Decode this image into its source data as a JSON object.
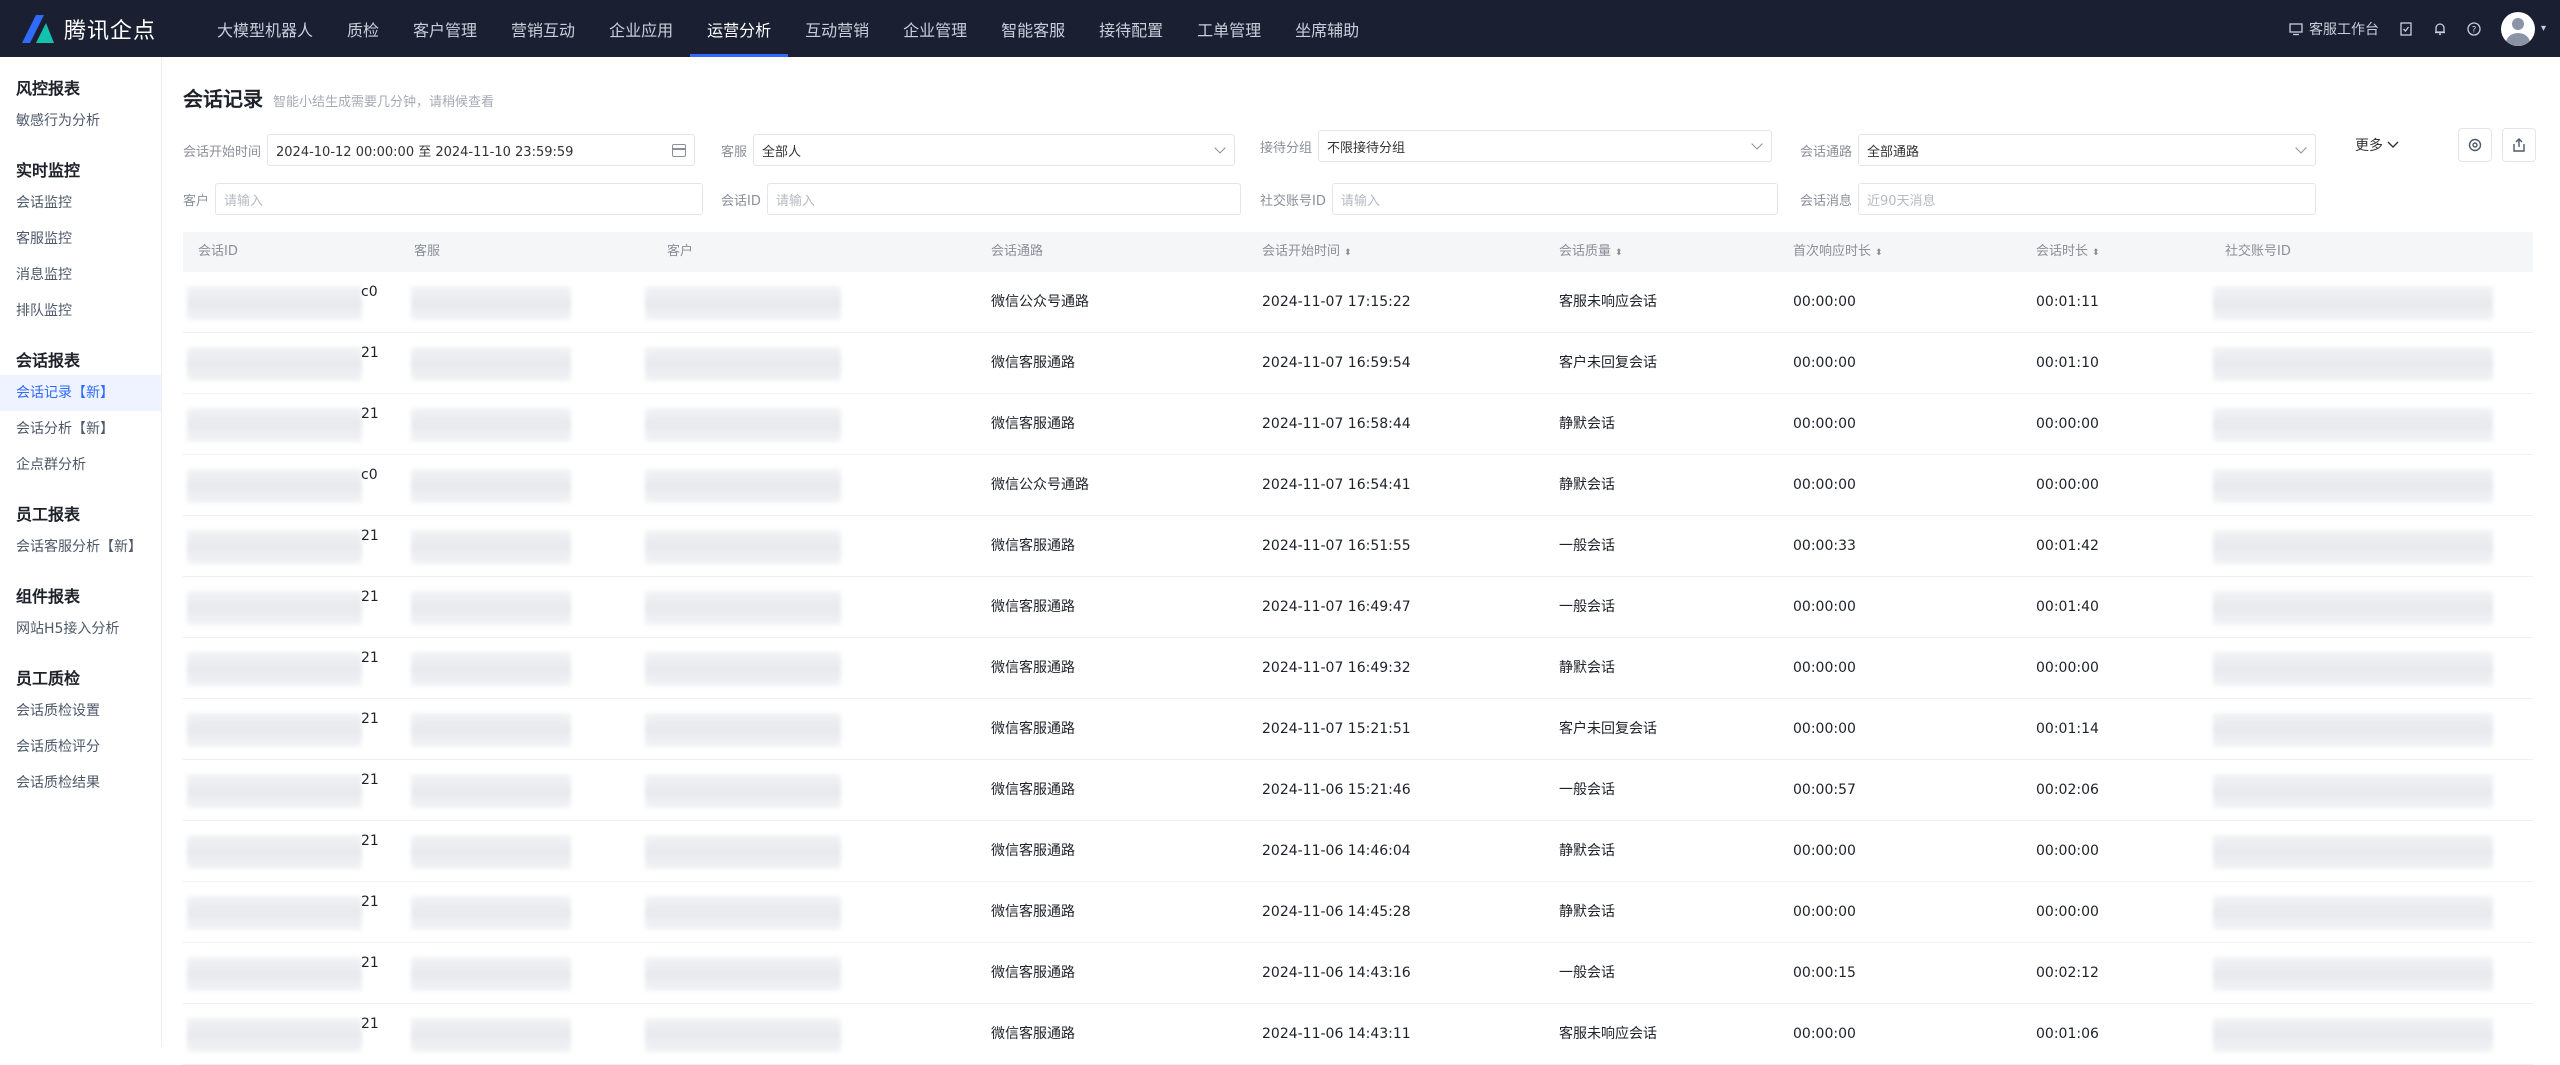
{
  "brand": {
    "name": "腾讯企点"
  },
  "nav": [
    {
      "label": "大模型机器人"
    },
    {
      "label": "质检"
    },
    {
      "label": "客户管理"
    },
    {
      "label": "营销互动"
    },
    {
      "label": "企业应用"
    },
    {
      "label": "运营分析",
      "active": true
    },
    {
      "label": "互动营销"
    },
    {
      "label": "企业管理"
    },
    {
      "label": "智能客服"
    },
    {
      "label": "接待配置"
    },
    {
      "label": "工单管理"
    },
    {
      "label": "坐席辅助"
    }
  ],
  "topright": {
    "workbench": "客服工作台"
  },
  "sidebar": [
    {
      "title": "风控报表",
      "items": [
        {
          "label": "敏感行为分析"
        }
      ]
    },
    {
      "title": "实时监控",
      "items": [
        {
          "label": "会话监控"
        },
        {
          "label": "客服监控"
        },
        {
          "label": "消息监控"
        },
        {
          "label": "排队监控"
        }
      ]
    },
    {
      "title": "会话报表",
      "items": [
        {
          "label": "会话记录【新】",
          "active": true
        },
        {
          "label": "会话分析【新】"
        },
        {
          "label": "企点群分析"
        }
      ]
    },
    {
      "title": "员工报表",
      "items": [
        {
          "label": "会话客服分析【新】"
        }
      ]
    },
    {
      "title": "组件报表",
      "items": [
        {
          "label": "网站H5接入分析"
        }
      ]
    },
    {
      "title": "员工质检",
      "items": [
        {
          "label": "会话质检设置"
        },
        {
          "label": "会话质检评分"
        },
        {
          "label": "会话质检结果"
        }
      ]
    }
  ],
  "page": {
    "title": "会话记录",
    "subtitle": "智能小结生成需要几分钟，请稍候查看"
  },
  "filters": {
    "start_time_label": "会话开始时间",
    "start_time_value": "2024-10-12 00:00:00 至 2024-11-10 23:59:59",
    "agent_label": "客服",
    "agent_value": "全部人",
    "group_label": "接待分组",
    "group_value": "不限接待分组",
    "channel_label": "会话通路",
    "channel_value": "全部通路",
    "more_label": "更多",
    "customer_label": "客户",
    "customer_placeholder": "请输入",
    "session_id_label": "会话ID",
    "session_id_placeholder": "请输入",
    "social_label": "社交账号ID",
    "social_placeholder": "请输入",
    "message_label": "会话消息",
    "message_placeholder": "近90天消息"
  },
  "table": {
    "headers": {
      "session_id": "会话ID",
      "agent": "客服",
      "customer": "客户",
      "channel": "会话通路",
      "start_time": "会话开始时间",
      "quality": "会话质量",
      "first_response": "首次响应时长",
      "duration": "会话时长",
      "social_id": "社交账号ID"
    },
    "rows": [
      {
        "id_tail": "c0",
        "channel": "微信公众号通路",
        "start": "2024-11-07 17:15:22",
        "quality": "客服未响应会话",
        "first": "00:00:00",
        "duration": "00:01:11"
      },
      {
        "id_tail": "21",
        "channel": "微信客服通路",
        "start": "2024-11-07 16:59:54",
        "quality": "客户未回复会话",
        "first": "00:00:00",
        "duration": "00:01:10"
      },
      {
        "id_tail": "21",
        "channel": "微信客服通路",
        "start": "2024-11-07 16:58:44",
        "quality": "静默会话",
        "first": "00:00:00",
        "duration": "00:00:00"
      },
      {
        "id_tail": "c0",
        "channel": "微信公众号通路",
        "start": "2024-11-07 16:54:41",
        "quality": "静默会话",
        "first": "00:00:00",
        "duration": "00:00:00"
      },
      {
        "id_tail": "21",
        "channel": "微信客服通路",
        "start": "2024-11-07 16:51:55",
        "quality": "一般会话",
        "first": "00:00:33",
        "duration": "00:01:42"
      },
      {
        "id_tail": "21",
        "channel": "微信客服通路",
        "start": "2024-11-07 16:49:47",
        "quality": "一般会话",
        "first": "00:00:00",
        "duration": "00:01:40"
      },
      {
        "id_tail": "21",
        "channel": "微信客服通路",
        "start": "2024-11-07 16:49:32",
        "quality": "静默会话",
        "first": "00:00:00",
        "duration": "00:00:00"
      },
      {
        "id_tail": "21",
        "channel": "微信客服通路",
        "start": "2024-11-07 15:21:51",
        "quality": "客户未回复会话",
        "first": "00:00:00",
        "duration": "00:01:14"
      },
      {
        "id_tail": "21",
        "channel": "微信客服通路",
        "start": "2024-11-06 15:21:46",
        "quality": "一般会话",
        "first": "00:00:57",
        "duration": "00:02:06"
      },
      {
        "id_tail": "21",
        "channel": "微信客服通路",
        "start": "2024-11-06 14:46:04",
        "quality": "静默会话",
        "first": "00:00:00",
        "duration": "00:00:00"
      },
      {
        "id_tail": "21",
        "channel": "微信客服通路",
        "start": "2024-11-06 14:45:28",
        "quality": "静默会话",
        "first": "00:00:00",
        "duration": "00:00:00"
      },
      {
        "id_tail": "21",
        "channel": "微信客服通路",
        "start": "2024-11-06 14:43:16",
        "quality": "一般会话",
        "first": "00:00:15",
        "duration": "00:02:12"
      },
      {
        "id_tail": "21",
        "channel": "微信客服通路",
        "start": "2024-11-06 14:43:11",
        "quality": "客服未响应会话",
        "first": "00:00:00",
        "duration": "00:01:06"
      }
    ]
  },
  "colors": {
    "topbar": "#1a2032",
    "accent": "#2f6bff",
    "active_side_bg": "#eef3ff"
  }
}
